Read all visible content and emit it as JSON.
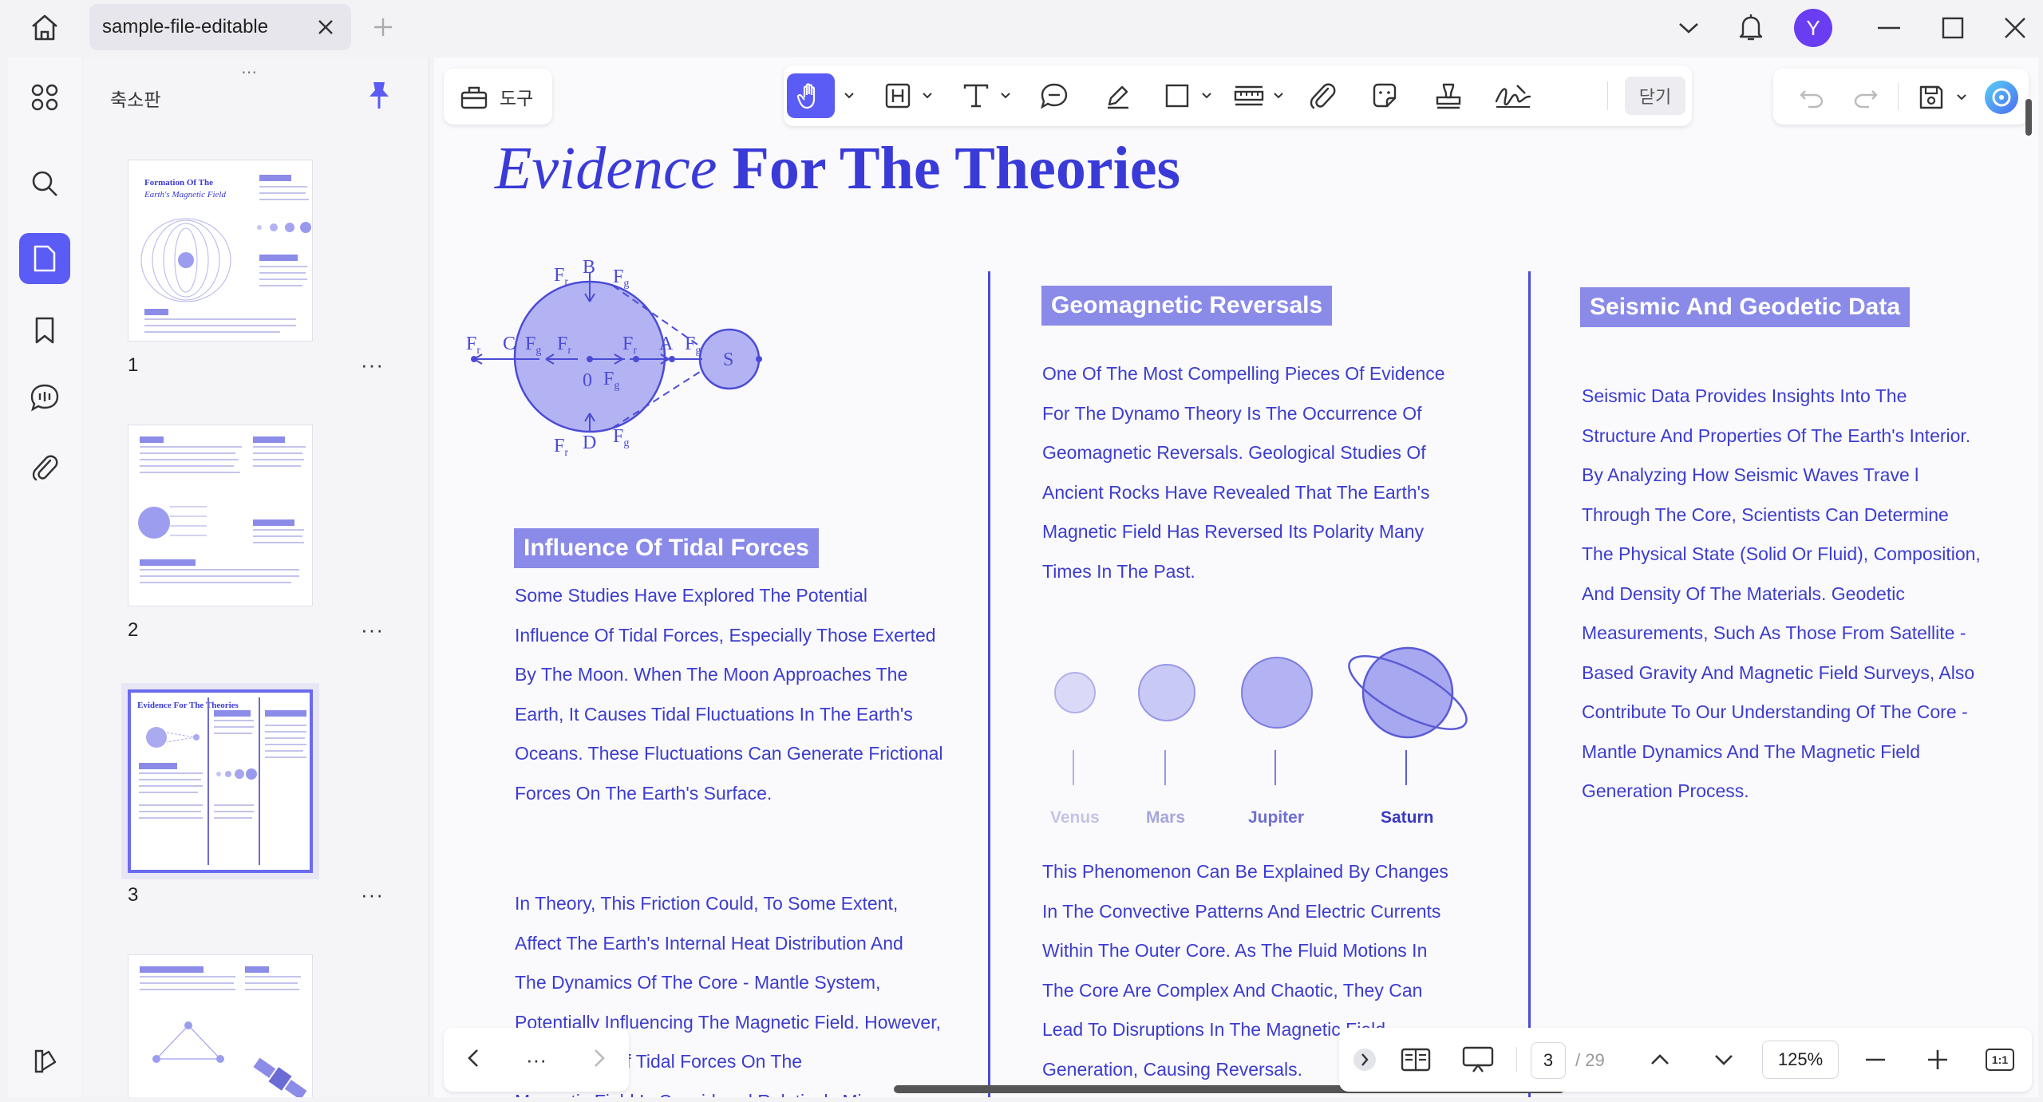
{
  "titlebar": {
    "tab_label": "sample-file-editable",
    "avatar_letter": "Y"
  },
  "thumbnails": {
    "panel_title": "축소판",
    "pages": [
      {
        "num": "1",
        "more": "···",
        "title": "Formation Of The",
        "subtitle": "Earth's Magnetic Field"
      },
      {
        "num": "2",
        "more": "···"
      },
      {
        "num": "3",
        "more": "···",
        "title": "Evidence For The Theories"
      },
      {
        "num": "",
        "more": ""
      }
    ]
  },
  "toolbar": {
    "tools_label": "도구",
    "close_label": "닫기"
  },
  "document": {
    "title_italic": "Evidence",
    "title_bold": "For The Theories",
    "diagram_labels": {
      "fr": "F",
      "fg": "F",
      "sub_r": "r",
      "sub_g": "g",
      "B": "B",
      "C": "C",
      "D": "D",
      "A": "A",
      "O": "0",
      "S": "S"
    },
    "tidal": {
      "heading": "Influence Of Tidal Forces",
      "para1": [
        "Some Studies Have Explored The Potential",
        "Influence Of Tidal Forces, Especially Those Exerted",
        "By The Moon. When The Moon Approaches The",
        "Earth, It Causes Tidal Fluctuations In The Earth's",
        "Oceans. These Fluctuations Can Generate Frictional",
        "Forces On The Earth's Surface."
      ],
      "para2": [
        " In Theory, This Friction Could, To Some Extent,",
        "Affect The Earth's Internal Heat Distribution And",
        "The Dynamics Of The Core - Mantle System,",
        "Potentially Influencing The Magnetic Field. However,",
        "The Impact Of Tidal Forces On The",
        "Magnetic Field Is Considered Relatively Minor"
      ]
    },
    "geomagnetic": {
      "heading": "Geomagnetic Reversals",
      "para1": [
        "One Of The Most Compelling Pieces Of Evidence",
        "For The Dynamo Theory Is The Occurrence Of",
        "Geomagnetic Reversals. Geological Studies Of",
        "Ancient Rocks Have Revealed That The Earth's",
        "Magnetic Field Has Reversed Its Polarity Many",
        "Times In The Past."
      ],
      "planets": [
        "Venus",
        "Mars",
        "Jupiter",
        "Saturn"
      ],
      "para2": [
        "This Phenomenon Can Be Explained By Changes",
        "In The Convective Patterns And Electric Currents",
        "Within The Outer Core. As The Fluid Motions In",
        "The Core Are Complex And Chaotic, They Can",
        "Lead To Disruptions In The Magnetic Field",
        "Generation, Causing Reversals."
      ]
    },
    "seismic": {
      "heading": "Seismic And Geodetic Data",
      "para1": [
        "Seismic Data Provides Insights Into The",
        "Structure And Properties Of The Earth's Interior.",
        "By Analyzing How Seismic Waves Trave l",
        "Through The Core, Scientists Can Determine",
        "The Physical State (Solid Or Fluid), Composition,",
        "And Density Of The Materials. Geodetic",
        "Measurements, Such As Those From Satellite -",
        "Based Gravity And Magnetic Field Surveys, Also",
        "Contribute To Our Understanding Of The Core -",
        "Mantle Dynamics And The Magnetic Field",
        "Generation Process."
      ]
    }
  },
  "bottom": {
    "nav_more": "···",
    "current_page": "3",
    "total_pages": "/ 29",
    "zoom": "125%",
    "fit_label": "1:1"
  },
  "colors": {
    "accent": "#5b5bf5",
    "doc_text": "#3c3ccf",
    "doc_heading_bg": "#8a8ae8",
    "planet_fill": "#b8b8f4"
  }
}
